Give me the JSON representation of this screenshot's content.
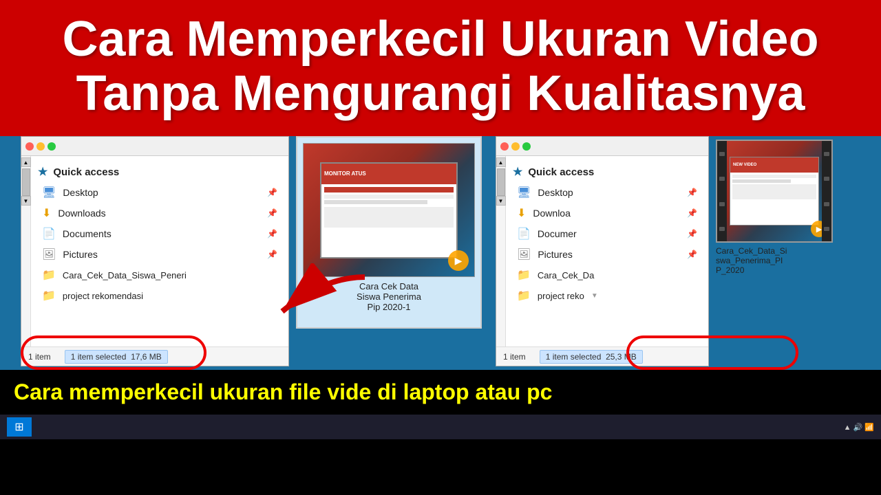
{
  "title_banner": {
    "line1": "Cara Memperkecil Ukuran Video",
    "line2": "Tanpa Mengurangi Kualitasnya"
  },
  "left_window": {
    "quick_access_label": "Quick access",
    "items": [
      {
        "name": "Desktop",
        "type": "desktop",
        "pinned": true
      },
      {
        "name": "Downloads",
        "type": "downloads",
        "pinned": true
      },
      {
        "name": "Documents",
        "type": "documents",
        "pinned": true
      },
      {
        "name": "Pictures",
        "type": "pictures",
        "pinned": true
      },
      {
        "name": "Cara_Cek_Data_Siswa_Peneri",
        "type": "folder",
        "pinned": false
      },
      {
        "name": "project rekomendasi",
        "type": "folder",
        "pinned": false
      }
    ],
    "status": {
      "item_count": "1 item",
      "selected": "1 item selected",
      "size": "17,6 MB"
    }
  },
  "right_window": {
    "quick_access_label": "Quick access",
    "items": [
      {
        "name": "Desktop",
        "type": "desktop",
        "pinned": true
      },
      {
        "name": "Downloa",
        "type": "downloads",
        "pinned": true
      },
      {
        "name": "Documer",
        "type": "documents",
        "pinned": true
      },
      {
        "name": "Pictures",
        "type": "pictures",
        "pinned": true
      },
      {
        "name": "Cara_Cek_Da",
        "type": "folder",
        "pinned": false
      },
      {
        "name": "project reko",
        "type": "folder",
        "pinned": false
      }
    ],
    "status": {
      "item_count": "1 item",
      "selected": "1 item selected",
      "size": "25,3 MB"
    }
  },
  "preview": {
    "label": "Cara Cek Data\nSiswa Penerima\nPip 2020-1",
    "label_right": "Cara_Cek_Data_Si\nswa_Penerima_PI\nP_2020"
  },
  "bottom": {
    "text": "Cara memperkecil ukuran file vide di laptop atau pc"
  }
}
